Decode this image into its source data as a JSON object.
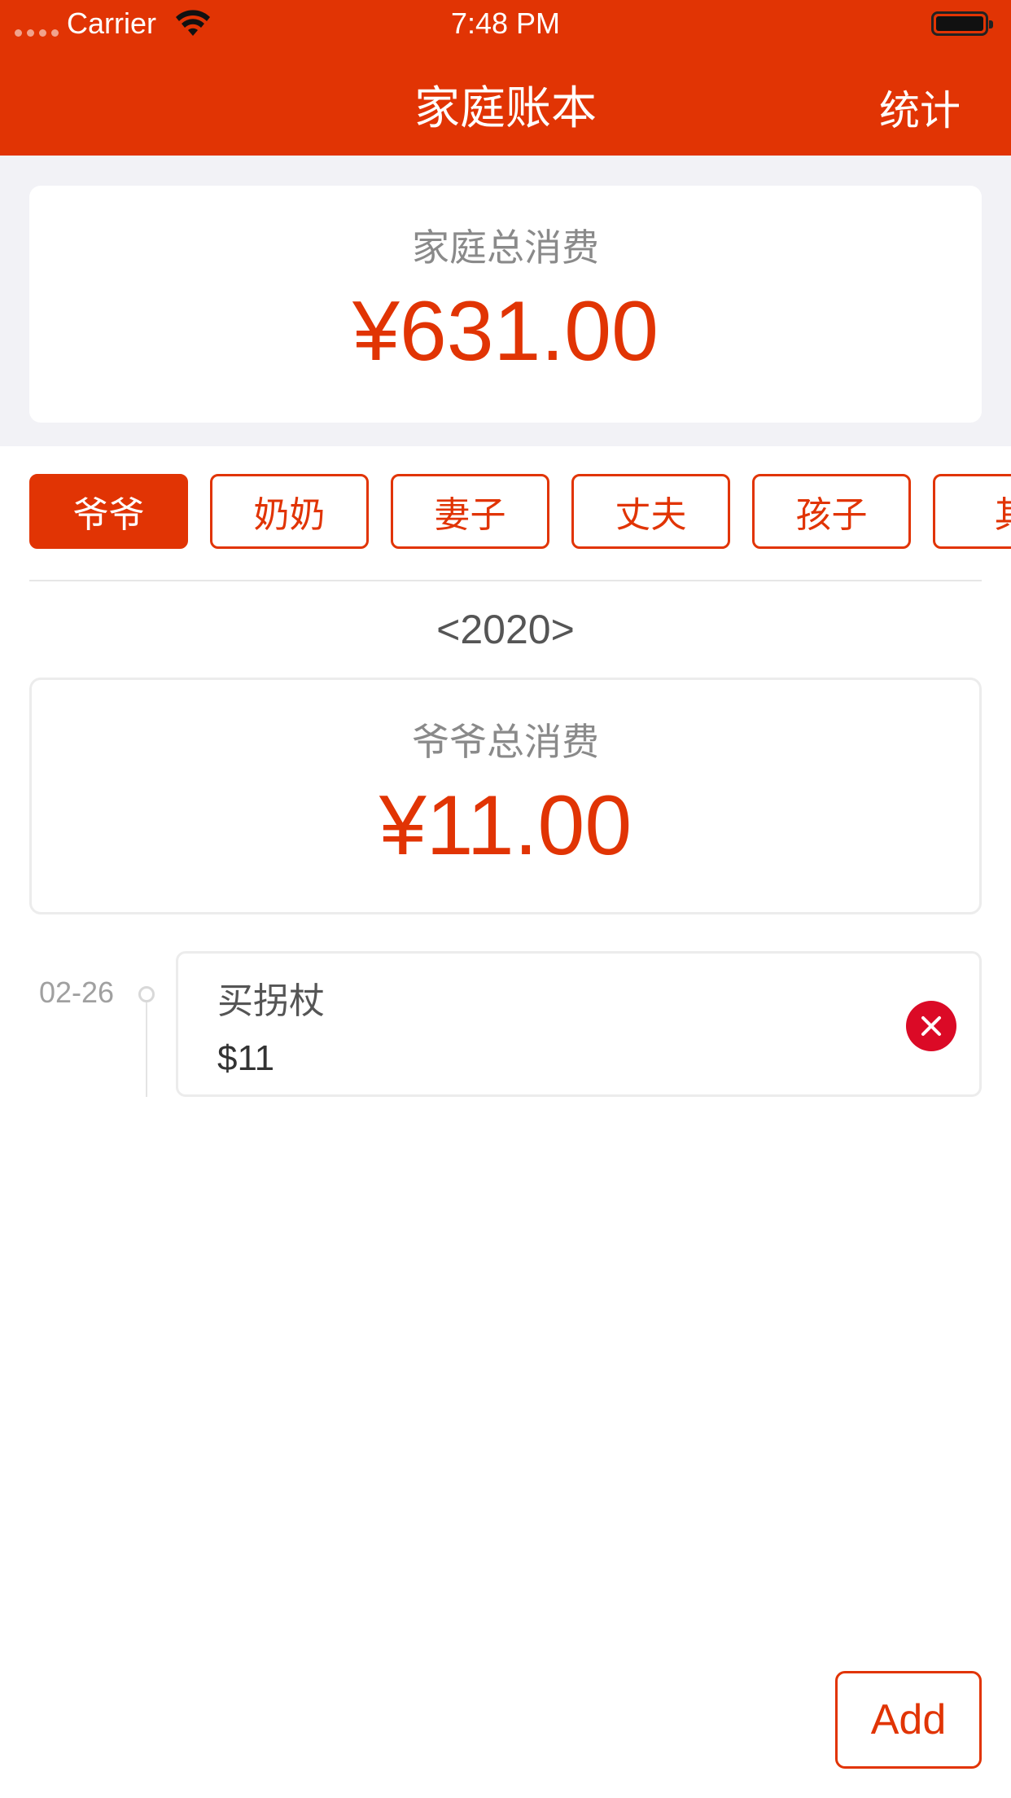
{
  "status_bar": {
    "carrier": "Carrier",
    "time": "7:48 PM",
    "icons": [
      "signal-icon",
      "wifi-icon",
      "battery-icon"
    ]
  },
  "nav": {
    "title": "家庭账本",
    "right_button": "统计"
  },
  "family_summary": {
    "label": "家庭总消费",
    "amount": "¥631.00"
  },
  "members": [
    "爷爷",
    "奶奶",
    "妻子",
    "丈夫",
    "孩子",
    "其"
  ],
  "selected_member": "爷爷",
  "year_selector": "<2020>",
  "member_summary": {
    "label": "爷爷总消费",
    "amount": "¥11.00"
  },
  "records": [
    {
      "date": "02-26",
      "name": "买拐杖",
      "amount": "$11"
    }
  ],
  "actions": {
    "add_label": "Add",
    "delete_icon": "close-circle-icon"
  },
  "colors": {
    "accent": "#e13404",
    "background_band": "#f2f2f6",
    "delete_red": "#db0a26",
    "muted_text": "#8a8a8a"
  }
}
